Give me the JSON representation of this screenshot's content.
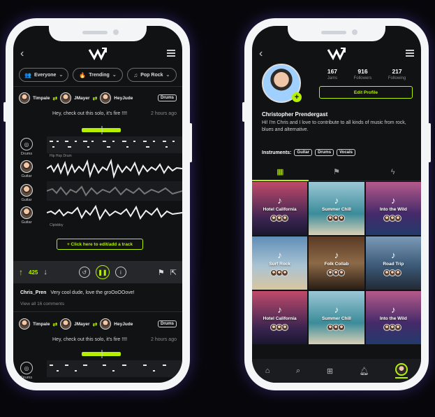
{
  "colors": {
    "accent": "#b4f000",
    "bg": "#111214"
  },
  "left": {
    "filters": [
      {
        "label": "Everyone",
        "icon": "users-icon"
      },
      {
        "label": "Trending",
        "icon": "flame-icon"
      },
      {
        "label": "Pop Rock",
        "icon": "music-icon"
      }
    ],
    "post1": {
      "users": [
        "Timpale",
        "JMayer",
        "HeyJude"
      ],
      "tag": "Drums",
      "message": "Hey, check out this solo, it's fire !!!!",
      "time": "2 hours ago"
    },
    "tracks": [
      {
        "label": "Drums",
        "caption": "Hip Hop Drum"
      },
      {
        "label": "Guitar",
        "caption": ""
      },
      {
        "label": "Guitar",
        "caption": ""
      },
      {
        "label": "Guitar",
        "caption": "Clplobby"
      }
    ],
    "cta": "+ Click here to edit/add a track",
    "votes": "425",
    "comment": {
      "user": "Chris_Pren",
      "text": "Very cool dude, love the groOoOOove!"
    },
    "view_all": "View all 16 comments",
    "post2": {
      "users": [
        "Timpale",
        "JMayer",
        "HeyJude"
      ],
      "tag": "Drums",
      "message": "Hey, check out this solo, it's fire !!!!",
      "time": "2 hours ago"
    },
    "post2_track_label": "Drums"
  },
  "right": {
    "stats": [
      {
        "n": "167",
        "l": "Jams"
      },
      {
        "n": "916",
        "l": "Followers"
      },
      {
        "n": "217",
        "l": "Following"
      }
    ],
    "edit_profile": "Edit Profile",
    "name": "Christopher Prendergast",
    "bio": "Hi! I'm Chris and I love to contribute to all kinds of music from rock, blues and alternative.",
    "instruments_label": "Instruments:",
    "instruments": [
      "Guitar",
      "Drums",
      "Vocals"
    ],
    "tiles": [
      {
        "title": "Hotel California",
        "bg": "linear-gradient(#c04a6a,#3a2450 70%,#1a1730)"
      },
      {
        "title": "Summer Chill",
        "bg": "linear-gradient(#9cc7d6,#3b8c9a 60%,#d9d0b6)"
      },
      {
        "title": "Into the Wild",
        "bg": "linear-gradient(#b45a8a,#452a6a 60%,#223a6a)"
      },
      {
        "title": "Surf Rock",
        "bg": "linear-gradient(#5f8eb8,#a9c3d3 55%,#d9c6a0)"
      },
      {
        "title": "Folk Collab",
        "bg": "linear-gradient(#5a3a24,#8c6a48 50%,#2a1d14)"
      },
      {
        "title": "Road Trip",
        "bg": "linear-gradient(#7a9ab8,#3c5a78 55%,#222a35)"
      },
      {
        "title": "Hotel California",
        "bg": "linear-gradient(#c04a6a,#3a2450 70%,#1a1730)"
      },
      {
        "title": "Summer Chill",
        "bg": "linear-gradient(#9cc7d6,#3b8c9a 60%,#d9d0b6)"
      },
      {
        "title": "Into the Wild",
        "bg": "linear-gradient(#b45a8a,#452a6a 60%,#223a6a)"
      }
    ]
  }
}
